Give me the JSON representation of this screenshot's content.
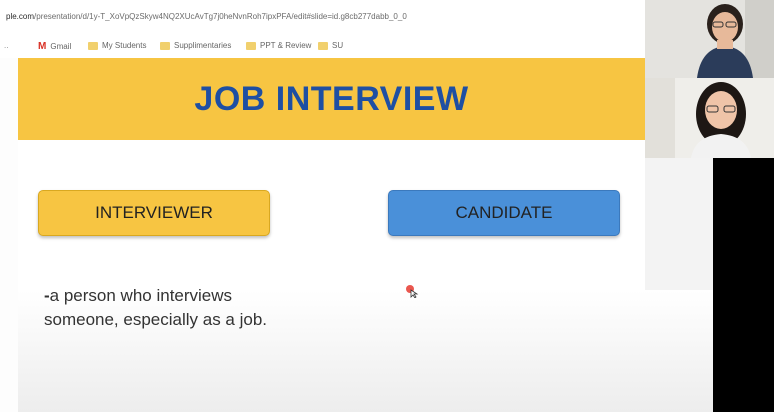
{
  "browser": {
    "url_host": "ple.com",
    "url_path": "/presentation/d/1y-T_XoVpQzSkyw4NQ2XUcAvTg7j0heNvnRoh7ipxPFA/edit#slide=id.g8cb277dabb_0_0",
    "bookmarks": [
      {
        "label": "Gmail",
        "icon": "gmail-icon"
      },
      {
        "label": "My Students",
        "icon": "folder-icon"
      },
      {
        "label": "Supplimentaries",
        "icon": "folder-icon"
      },
      {
        "label": "PPT & Review",
        "icon": "folder-icon"
      },
      {
        "label": "SU",
        "icon": "folder-icon"
      }
    ]
  },
  "slide": {
    "title": "JOB INTERVIEW",
    "interviewer_label": "INTERVIEWER",
    "candidate_label": "CANDIDATE",
    "definition_dash": "-",
    "definition_line1": "a person who interviews",
    "definition_line2": "someone, especially as a job."
  },
  "colors": {
    "title_band": "#f7c542",
    "title_text": "#1e4fa3",
    "interviewer_button": "#f7c542",
    "candidate_button": "#4a90d9"
  }
}
